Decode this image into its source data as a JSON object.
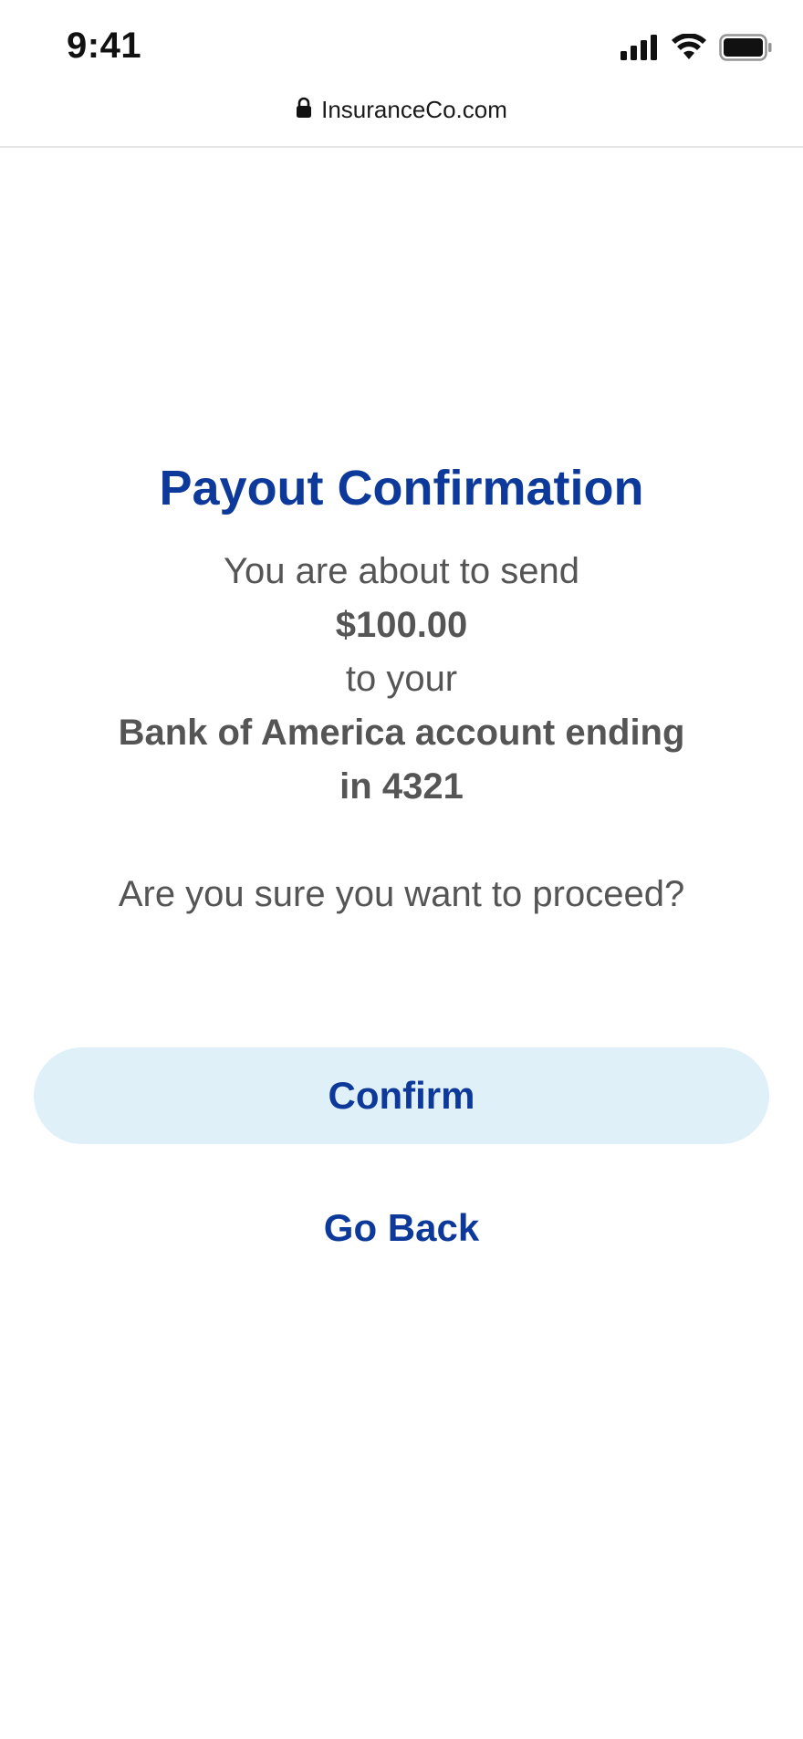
{
  "status_bar": {
    "time": "9:41",
    "signal_icon": "cellular-signal-icon",
    "wifi_icon": "wifi-icon",
    "battery_icon": "battery-icon"
  },
  "browser": {
    "lock_icon": "lock-icon",
    "url": "InsuranceCo.com"
  },
  "confirmation": {
    "title": "Payout Confirmation",
    "intro": "You are about to send",
    "amount": "$100.00",
    "connector": "to your",
    "account_line1": "Bank of America account ending",
    "account_line2": "in 4321",
    "question": "Are you sure you want to proceed?"
  },
  "actions": {
    "confirm_label": "Confirm",
    "back_label": "Go Back"
  },
  "colors": {
    "accent": "#0d3a9a",
    "confirm_bg": "#dff0f8",
    "body_text": "#555555"
  }
}
